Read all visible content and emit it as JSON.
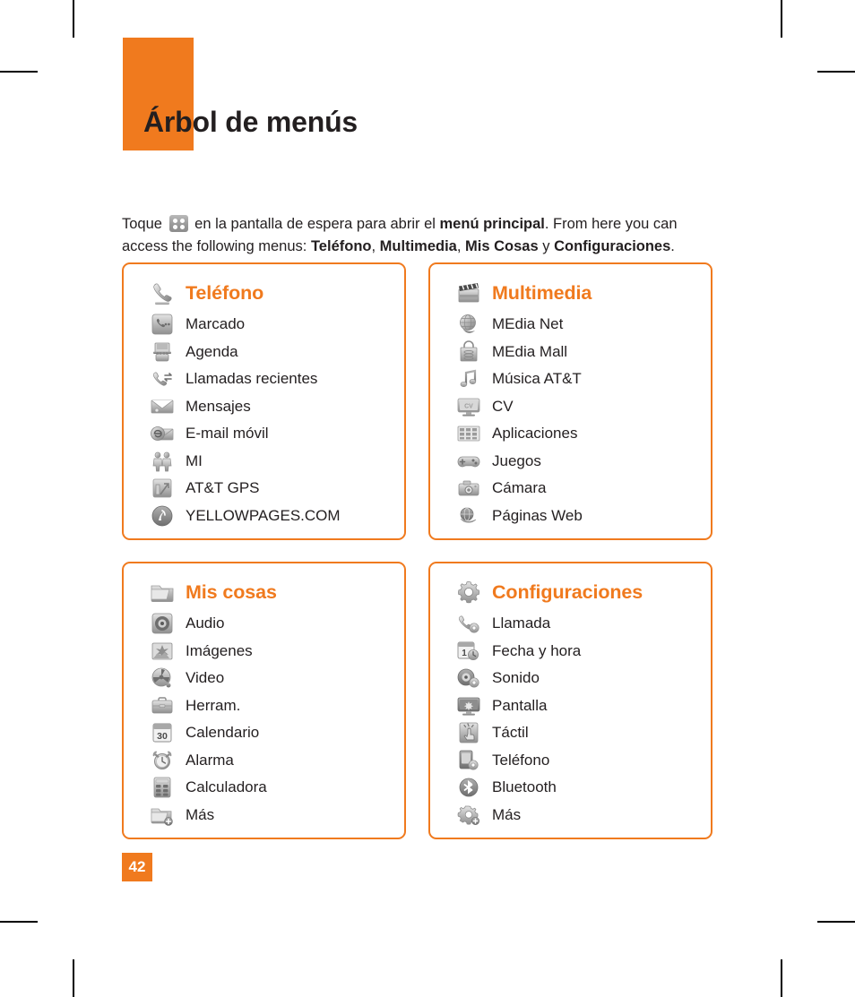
{
  "page": {
    "title": "Árbol de menús",
    "number": "42",
    "accent_color": "#F07A1E",
    "text_color": "#231f20"
  },
  "intro": {
    "part1": "Toque",
    "icon": "grid-menu-icon",
    "part2": "en la pantalla de espera para abrir el",
    "bold1": "menú principal",
    "part3": ". From here you can access the following menus:",
    "bold2": "Teléfono",
    "sep1": ",",
    "bold3": "Multimedia",
    "sep2": ",",
    "bold4": "Mis Cosas",
    "conj": "y",
    "bold5": "Configuraciones",
    "end": "."
  },
  "panels": [
    {
      "id": "telefono",
      "heading": "Teléfono",
      "heading_icon": "phone-handset-icon",
      "items": [
        {
          "label": "Marcado",
          "icon": "dialer-icon"
        },
        {
          "label": "Agenda",
          "icon": "contacts-book-icon"
        },
        {
          "label": "Llamadas recientes",
          "icon": "recent-calls-icon"
        },
        {
          "label": "Mensajes",
          "icon": "envelope-icon"
        },
        {
          "label": "E-mail móvil",
          "icon": "email-icon"
        },
        {
          "label": "MI",
          "icon": "instant-messaging-icon"
        },
        {
          "label": "AT&T GPS",
          "icon": "gps-navigation-icon"
        },
        {
          "label": "YELLOWPAGES.COM",
          "icon": "yellowpages-icon"
        }
      ]
    },
    {
      "id": "multimedia",
      "heading": "Multimedia",
      "heading_icon": "clapperboard-icon",
      "items": [
        {
          "label": "MEdia Net",
          "icon": "globe-net-icon"
        },
        {
          "label": "MEdia Mall",
          "icon": "shopping-bag-icon"
        },
        {
          "label": "Música AT&T",
          "icon": "music-note-icon"
        },
        {
          "label": "CV",
          "icon": "cv-monitor-icon"
        },
        {
          "label": "Aplicaciones",
          "icon": "applications-grid-icon"
        },
        {
          "label": "Juegos",
          "icon": "gamepad-icon"
        },
        {
          "label": "Cámara",
          "icon": "camera-icon"
        },
        {
          "label": "Páginas Web",
          "icon": "web-pages-icon"
        }
      ]
    },
    {
      "id": "mis-cosas",
      "heading": "Mis cosas",
      "heading_icon": "folder-icon",
      "items": [
        {
          "label": "Audio",
          "icon": "audio-disc-icon"
        },
        {
          "label": "Imágenes",
          "icon": "images-icon"
        },
        {
          "label": "Video",
          "icon": "video-reel-icon"
        },
        {
          "label": "Herram.",
          "icon": "toolbox-icon"
        },
        {
          "label": "Calendario",
          "icon": "calendar-icon",
          "badge": "30"
        },
        {
          "label": "Alarma",
          "icon": "alarm-clock-icon"
        },
        {
          "label": "Calculadora",
          "icon": "calculator-icon"
        },
        {
          "label": "Más",
          "icon": "folder-add-icon"
        }
      ]
    },
    {
      "id": "configuraciones",
      "heading": "Configuraciones",
      "heading_icon": "gear-icon",
      "items": [
        {
          "label": "Llamada",
          "icon": "call-settings-icon"
        },
        {
          "label": "Fecha y hora",
          "icon": "date-time-icon",
          "badge": "1"
        },
        {
          "label": "Sonido",
          "icon": "sound-settings-icon"
        },
        {
          "label": "Pantalla",
          "icon": "display-monitor-icon"
        },
        {
          "label": "Táctil",
          "icon": "touch-icon"
        },
        {
          "label": "Teléfono",
          "icon": "phone-settings-icon"
        },
        {
          "label": "Bluetooth",
          "icon": "bluetooth-icon"
        },
        {
          "label": "Más",
          "icon": "gear-add-icon"
        }
      ]
    }
  ]
}
